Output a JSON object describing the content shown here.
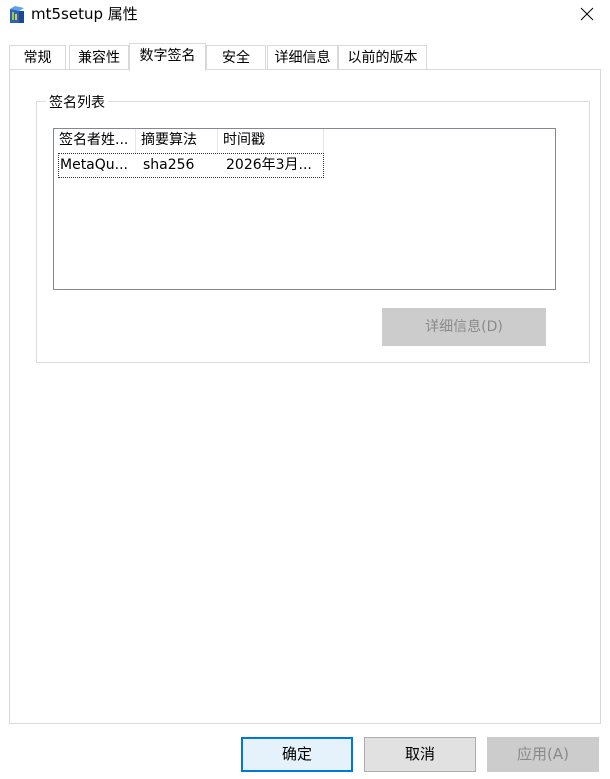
{
  "window": {
    "title": "mt5setup 属性",
    "close_glyph": "✕"
  },
  "tabs": [
    {
      "label": "常规"
    },
    {
      "label": "兼容性"
    },
    {
      "label": "数字签名",
      "active": true
    },
    {
      "label": "安全"
    },
    {
      "label": "详细信息"
    },
    {
      "label": "以前的版本"
    }
  ],
  "signatures": {
    "group_label": "签名列表",
    "columns": [
      "签名者姓...",
      "摘要算法",
      "时间戳"
    ],
    "rows": [
      {
        "signer": "MetaQu...",
        "digest": "sha256",
        "timestamp": "2026年3月..."
      }
    ],
    "details_button": "详细信息(D)"
  },
  "buttons": {
    "ok": "确定",
    "cancel": "取消",
    "apply": "应用(A)"
  },
  "colors": {
    "accent": "#0078d7",
    "disabled_bg": "#cccccc",
    "disabled_text": "#8a8a8a"
  },
  "icons": {
    "app": "installer-box-icon",
    "close": "close-icon"
  }
}
